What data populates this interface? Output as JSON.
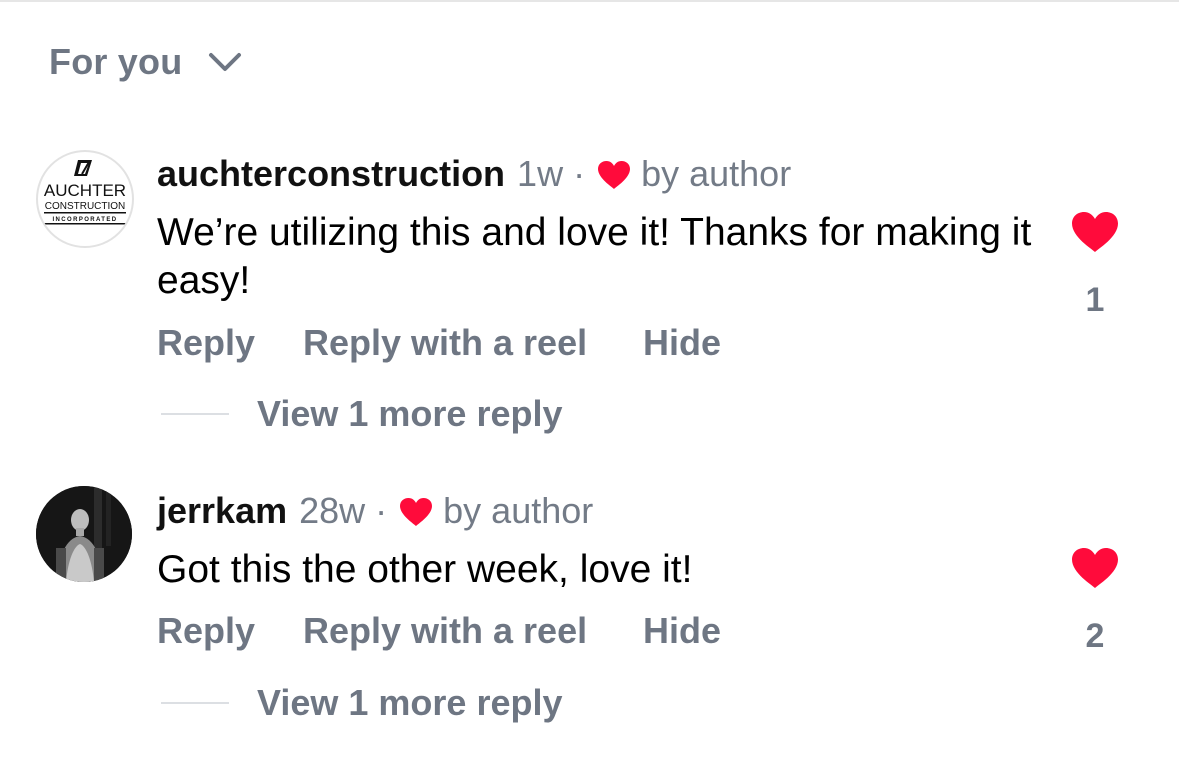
{
  "header": {
    "sort_label": "For you",
    "sort_icon": "chevron-down-icon"
  },
  "colors": {
    "heart_red": "#ff0b3b",
    "muted_text": "#6e7683"
  },
  "comments": [
    {
      "username": "auchterconstruction",
      "time": "1w",
      "separator": "·",
      "liked_by_author_label": "by author",
      "text": "We’re utilizing this and love it! Thanks for making it easy!",
      "like_count": "1",
      "actions": {
        "reply": "Reply",
        "reply_with_reel": "Reply with a reel",
        "hide": "Hide"
      },
      "more_replies": "View 1 more reply",
      "avatar_logo": {
        "line1": "AUCHTER",
        "line2": "CONSTRUCTION",
        "line3": "INCORPORATED"
      }
    },
    {
      "username": "jerrkam",
      "time": "28w",
      "separator": "·",
      "liked_by_author_label": "by author",
      "text": "Got this the other week, love it!",
      "like_count": "2",
      "actions": {
        "reply": "Reply",
        "reply_with_reel": "Reply with a reel",
        "hide": "Hide"
      },
      "more_replies": "View 1 more reply"
    }
  ]
}
